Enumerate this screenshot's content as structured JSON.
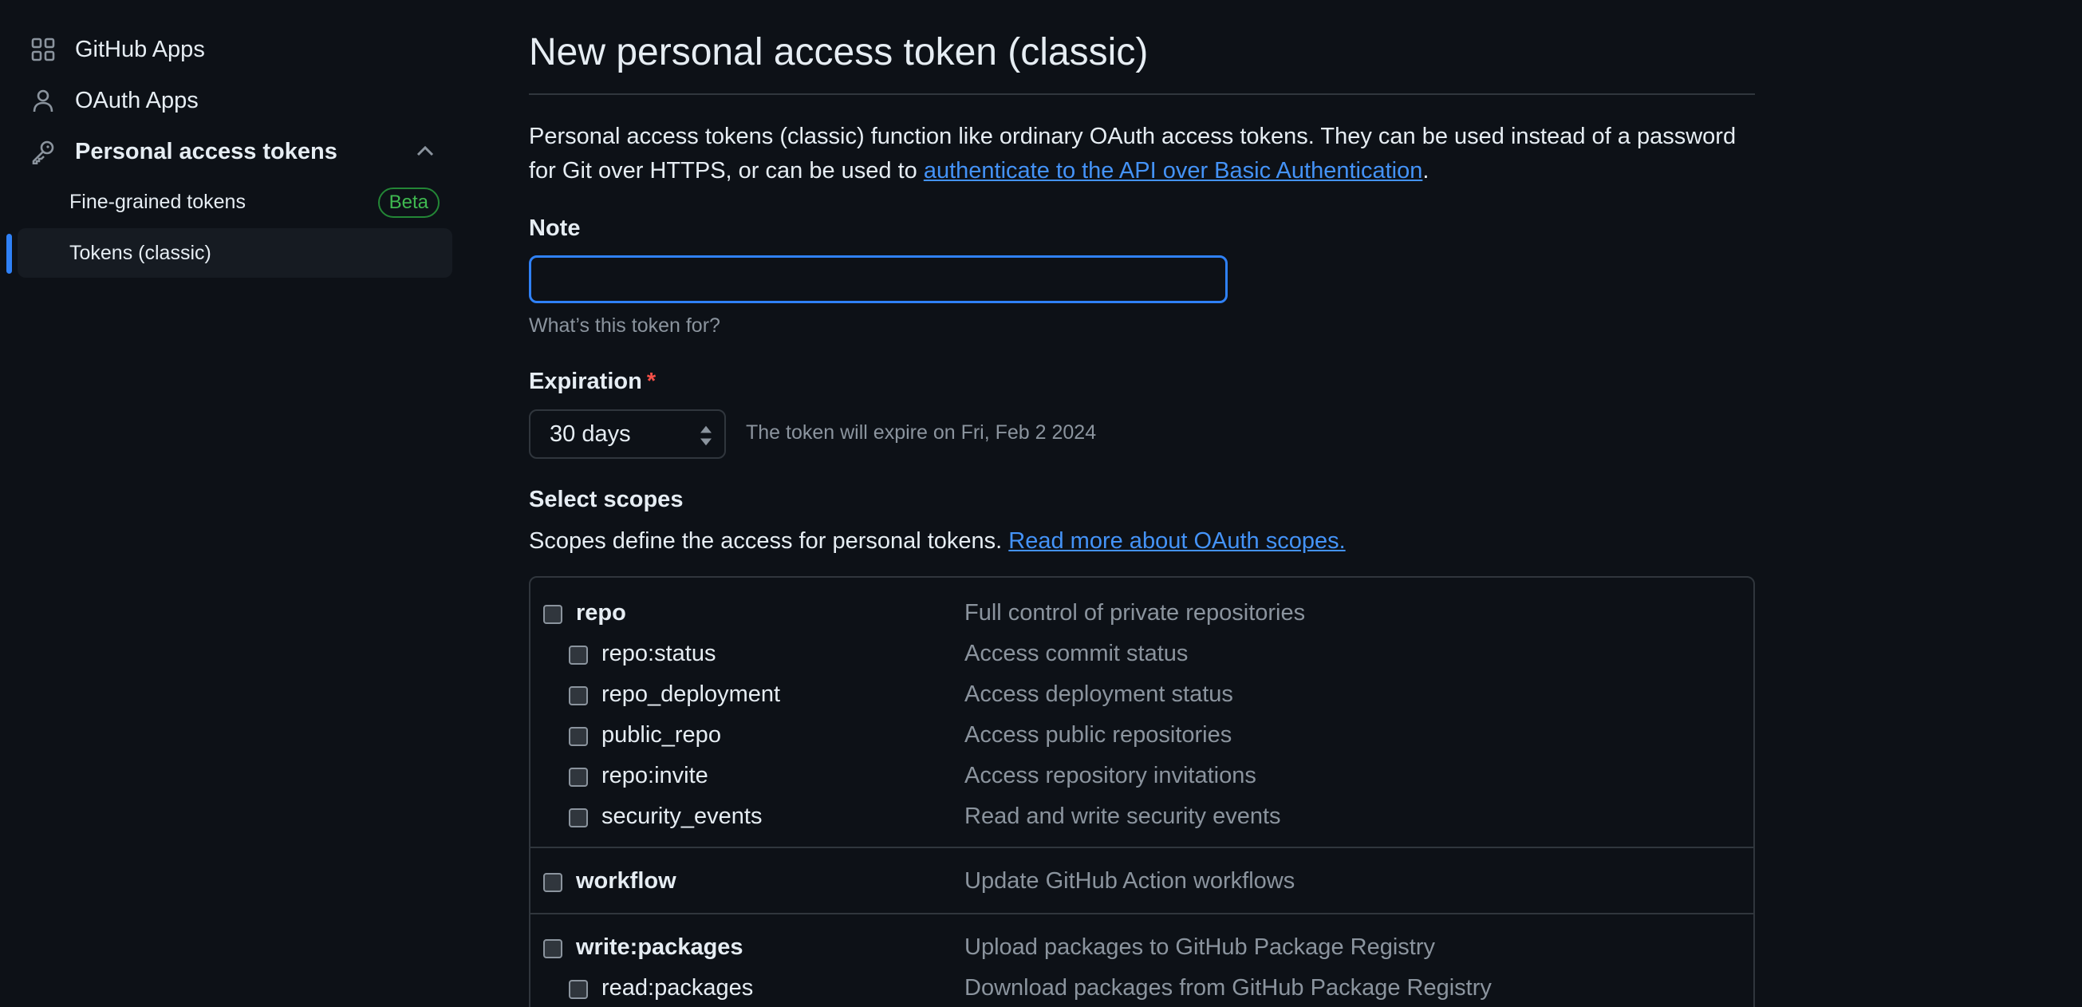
{
  "sidebar": {
    "items": [
      {
        "label": "GitHub Apps",
        "icon": "apps-grid-icon"
      },
      {
        "label": "OAuth Apps",
        "icon": "person-icon"
      },
      {
        "label": "Personal access tokens",
        "icon": "key-icon"
      }
    ],
    "sub_items": [
      {
        "label": "Fine-grained tokens",
        "badge": "Beta"
      },
      {
        "label": "Tokens (classic)"
      }
    ]
  },
  "main": {
    "title": "New personal access token (classic)",
    "intro_text": "Personal access tokens (classic) function like ordinary OAuth access tokens. They can be used instead of a password for Git over HTTPS, or can be used to ",
    "intro_link": "authenticate to the API over Basic Authentication",
    "intro_end": ".",
    "note": {
      "label": "Note",
      "value": "",
      "placeholder": "",
      "hint": "What’s this token for?"
    },
    "expiration": {
      "label": "Expiration",
      "required_mark": "*",
      "selected": "30 days",
      "note": "The token will expire on Fri, Feb 2 2024"
    },
    "scopes": {
      "heading": "Select scopes",
      "description": "Scopes define the access for personal tokens. ",
      "link": "Read more about OAuth scopes.",
      "rows": [
        {
          "name": "repo",
          "desc": "Full control of private repositories"
        },
        {
          "name": "repo:status",
          "desc": "Access commit status"
        },
        {
          "name": "repo_deployment",
          "desc": "Access deployment status"
        },
        {
          "name": "public_repo",
          "desc": "Access public repositories"
        },
        {
          "name": "repo:invite",
          "desc": "Access repository invitations"
        },
        {
          "name": "security_events",
          "desc": "Read and write security events"
        },
        {
          "name": "workflow",
          "desc": "Update GitHub Action workflows"
        },
        {
          "name": "write:packages",
          "desc": "Upload packages to GitHub Package Registry"
        },
        {
          "name": "read:packages",
          "desc": "Download packages from GitHub Package Registry"
        }
      ]
    }
  },
  "colors": {
    "background": "#0d1117",
    "accent": "#2f81f7",
    "link": "#4493f8",
    "badge_green": "#3fb950",
    "required_red": "#f85149"
  }
}
